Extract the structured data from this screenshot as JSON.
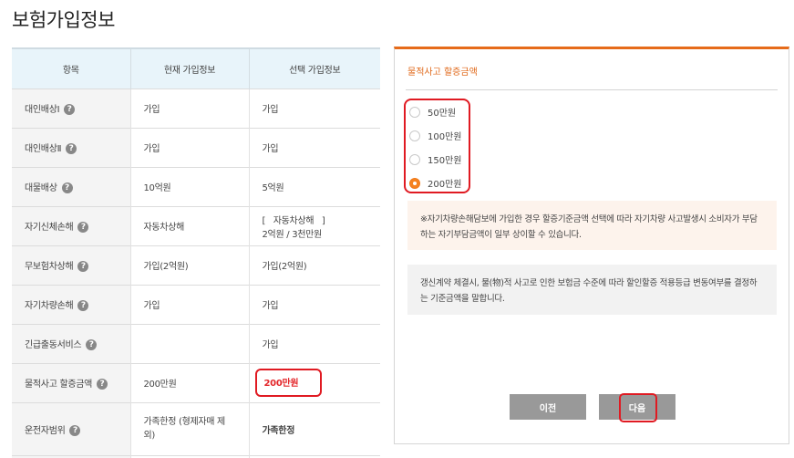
{
  "page_title": "보험가입정보",
  "table": {
    "headers": [
      "항목",
      "현재 가입정보",
      "선택 가입정보"
    ],
    "rows": [
      {
        "label": "대인배상Ⅰ",
        "current": "가입",
        "selected": "가입"
      },
      {
        "label": "대인배상Ⅱ",
        "current": "가입",
        "selected": "가입"
      },
      {
        "label": "대물배상",
        "current": "10억원",
        "selected": "5억원"
      },
      {
        "label": "자기신체손해",
        "current": "자동차상해",
        "selected": "[   자동차상해   ]",
        "selected_sub": "2억원 / 3천만원"
      },
      {
        "label": "무보험차상해",
        "current": "가입(2억원)",
        "selected": "가입(2억원)"
      },
      {
        "label": "자기차량손해",
        "current": "가입",
        "selected": "가입"
      },
      {
        "label": "긴급출동서비스",
        "current": "",
        "selected": "가입"
      },
      {
        "label": "물적사고 할증금액",
        "current": "200만원",
        "selected": "200만원"
      },
      {
        "label": "운전자범위",
        "current": "가족한정 (형제자매 제외)",
        "selected": "가족한정"
      }
    ]
  },
  "panel": {
    "title": "물적사고 할증금액",
    "options": [
      "50만원",
      "100만원",
      "150만원",
      "200만원"
    ],
    "selected_option": "200만원",
    "notice_orange": "※자기차량손해담보에 가입한 경우 할증기준금액 선택에 따라 자기차량 사고발생시 소비자가 부담하는 자기부담금액이 일부 상이할 수 있습니다.",
    "notice_gray": "갱신계약 체결시, 물(物)적 사고로 인한 보험금 수준에 따라 할인할증 적용등급 변동여부를 결정하는 기준금액을 말합니다.",
    "prev_label": "이전",
    "next_label": "다음"
  },
  "colors": {
    "accent": "#e66b1a",
    "highlight_red": "#e01a22",
    "header_bg": "#e8f4fa",
    "button_gray": "#999999"
  }
}
